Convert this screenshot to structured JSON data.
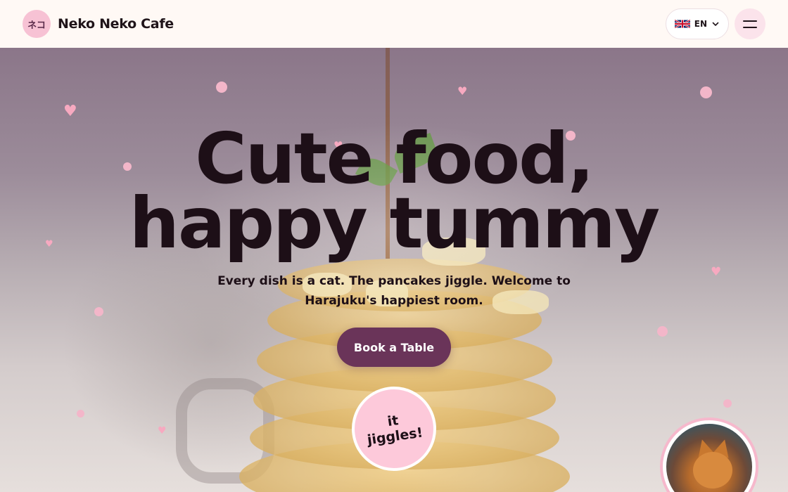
{
  "header": {
    "logo_badge": "ネコ",
    "brand_name": "Neko Neko Cafe",
    "language_label": "EN",
    "language_icon": "uk-flag-icon",
    "menu_icon": "hamburger-menu-icon"
  },
  "hero": {
    "title_line1": "Cute food,",
    "title_line2": "happy tummy",
    "subtitle": "Every dish is a cat. The pancakes jiggle. Welcome to Harajuku's happiest room.",
    "cta_label": "Book a Table",
    "sticker_line1": "it",
    "sticker_line2": "jiggles!"
  },
  "colors": {
    "accent": "#6a3459",
    "pink": "#f3b6c9",
    "text": "#1d0f17",
    "background": "#fff9f5"
  }
}
